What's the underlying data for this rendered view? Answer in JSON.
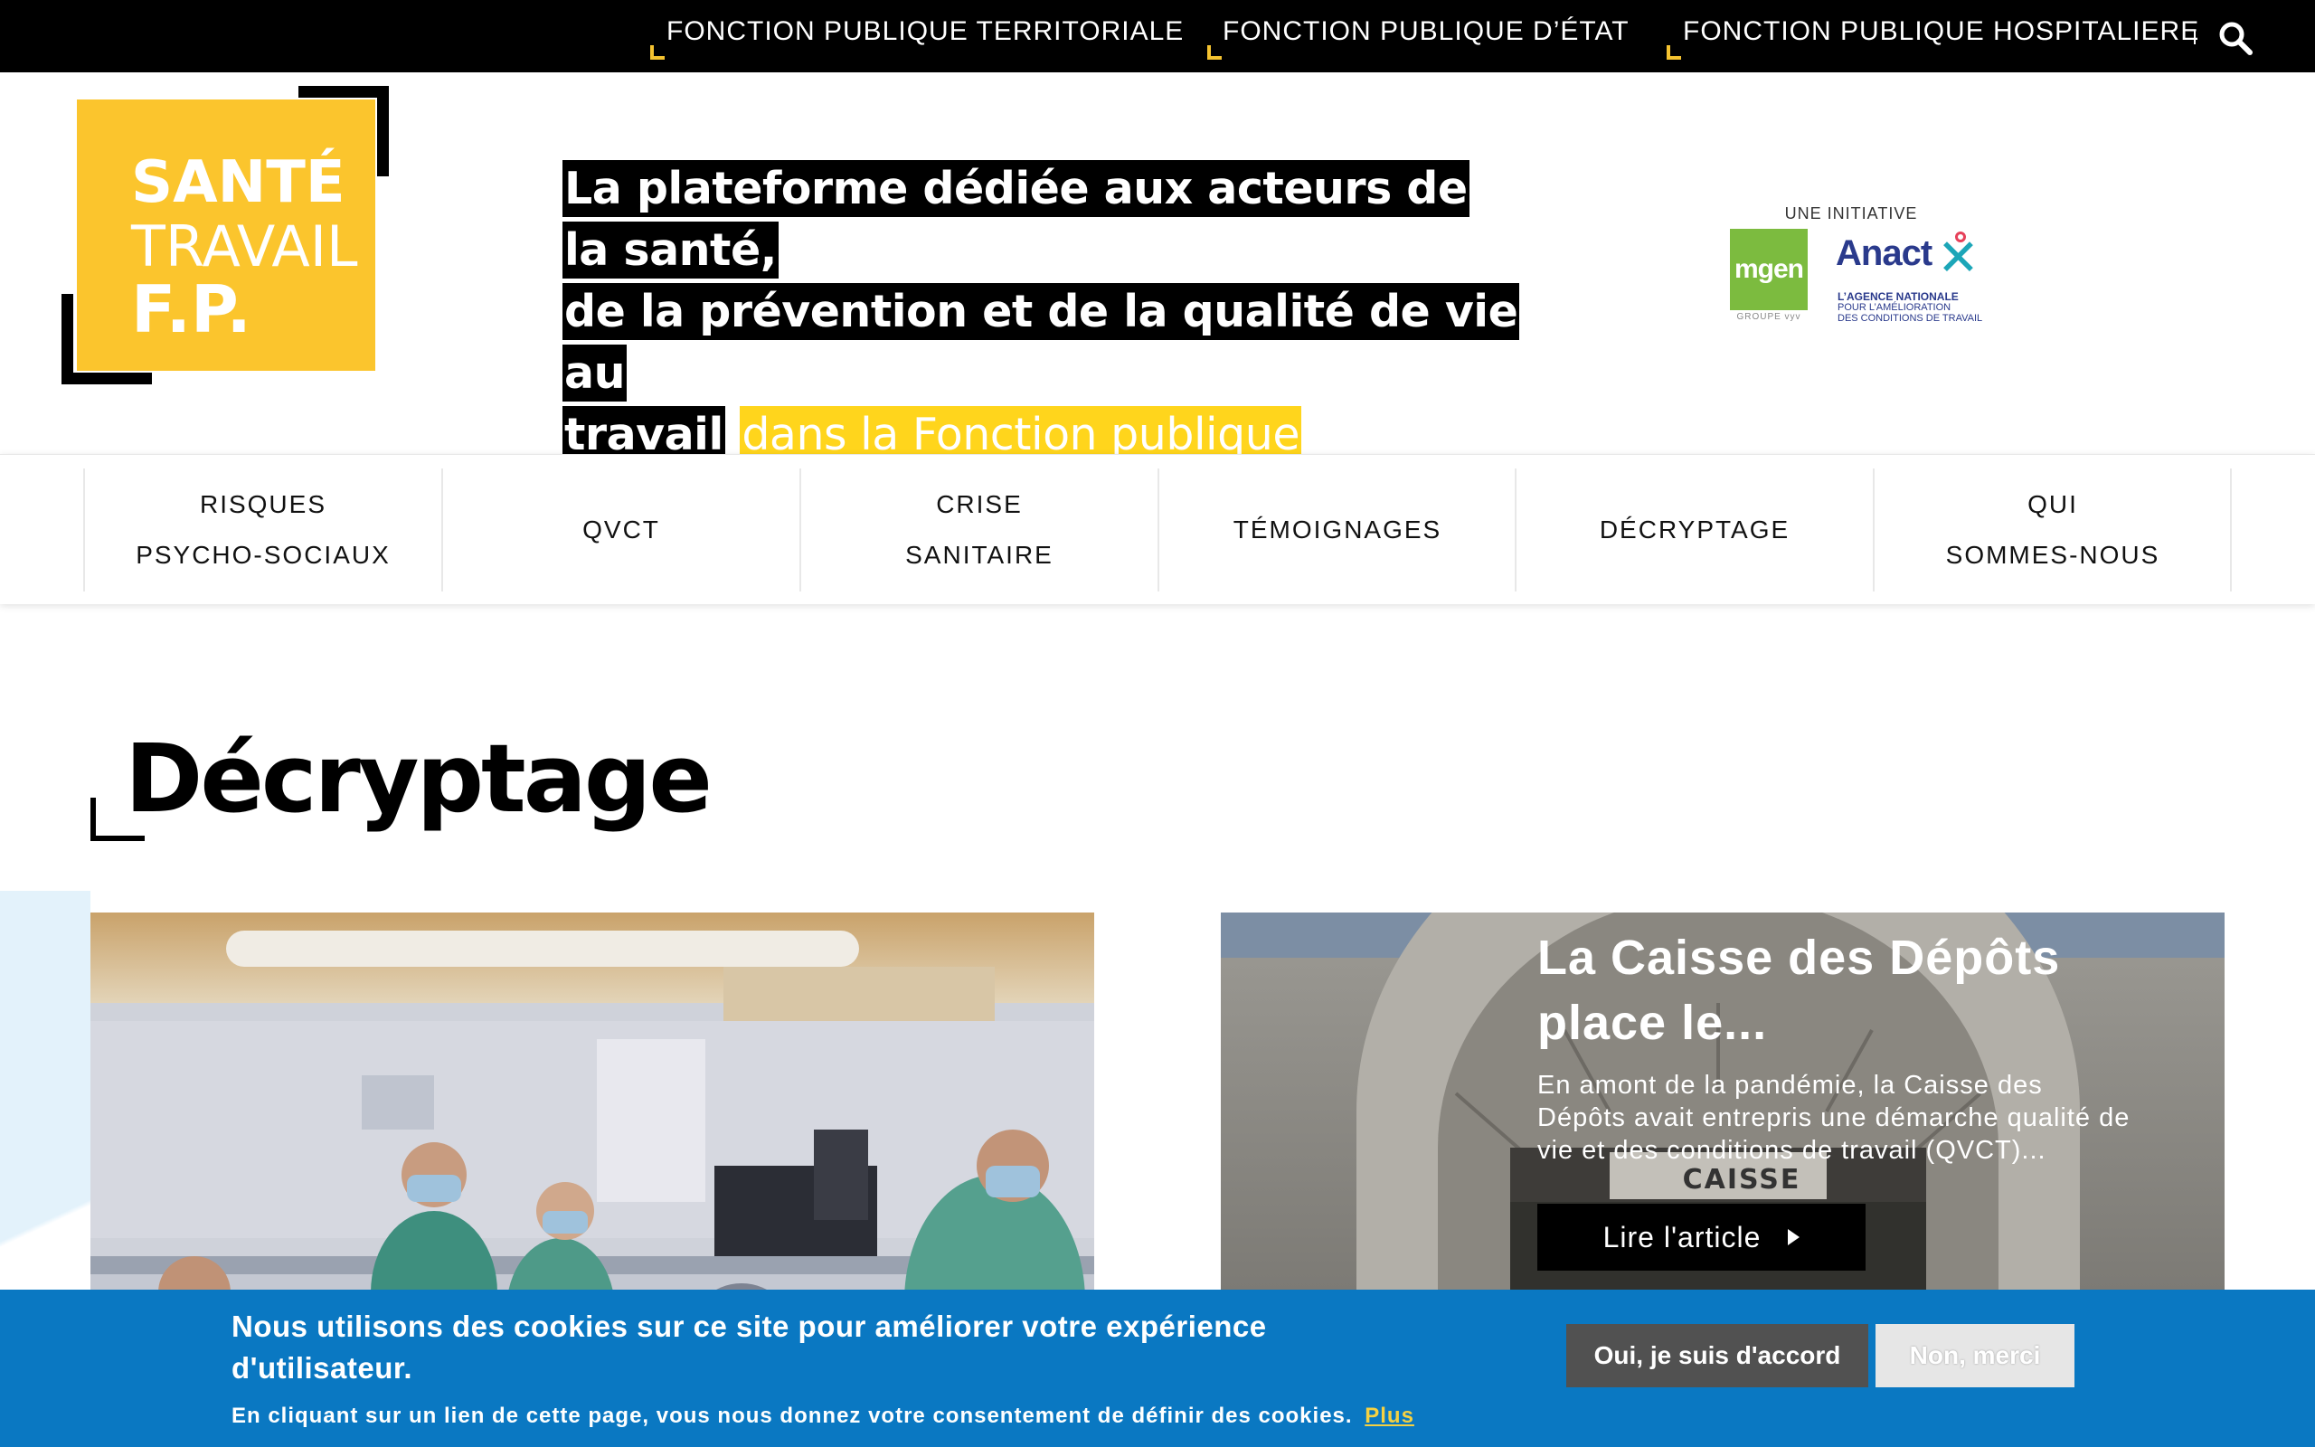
{
  "top_bar": {
    "links": [
      "FONCTION PUBLIQUE TERRITORIALE",
      "FONCTION PUBLIQUE D’ÉTAT",
      "FONCTION PUBLIQUE HOSPITALIERE"
    ],
    "search_icon": "search-icon"
  },
  "logo": {
    "line1": "SANTÉ",
    "line2": "TRAVAIL",
    "line3": "F.P."
  },
  "tagline": {
    "part_black_1": "La plateforme dédiée aux acteurs de la santé,",
    "part_black_2": "de la prévention et de la qualité de vie au",
    "part_black_3": "travail",
    "part_yellow": "dans la Fonction publique"
  },
  "partners": {
    "label": "UNE INITIATIVE",
    "mgen": "mgen",
    "mgen_sub": "GROUPE vyv",
    "anact": "Anact",
    "anact_sub_bold": "L’AGENCE NATIONALE",
    "anact_sub_1": "POUR L’AMÉLIORATION",
    "anact_sub_2": "DES CONDITIONS DE TRAVAIL"
  },
  "nav": {
    "items": [
      {
        "line1": "RISQUES",
        "line2": "PSYCHO-SOCIAUX"
      },
      {
        "line1": "QVCT",
        "line2": ""
      },
      {
        "line1": "CRISE",
        "line2": "SANITAIRE"
      },
      {
        "line1": "TÉMOIGNAGES",
        "line2": ""
      },
      {
        "line1": "DÉCRYPTAGE",
        "line2": ""
      },
      {
        "line1": "QUI",
        "line2": "SOMMES-NOUS"
      }
    ]
  },
  "page": {
    "title": "Décryptage"
  },
  "featured_card": {
    "title": "La Caisse des Dépôts place le...",
    "description": "En amont de la pandémie, la Caisse des Dépôts avait entrepris une démarche qualité de vie et des conditions de travail (QVCT)...",
    "button_label": "Lire l'article",
    "building_sign": "CAISSE"
  },
  "cookie_banner": {
    "message": "Nous utilisons des cookies sur ce site pour améliorer votre expérience d'utilisateur.",
    "consent_text": "En cliquant sur un lien de cette page, vous nous donnez votre consentement de définir des cookies.",
    "more_link": "Plus",
    "accept_label": "Oui, je suis d'accord",
    "decline_label": "Non, merci"
  },
  "colors": {
    "brand_yellow": "#fbc52d",
    "cookie_blue": "#0a78c2",
    "black": "#000000"
  }
}
